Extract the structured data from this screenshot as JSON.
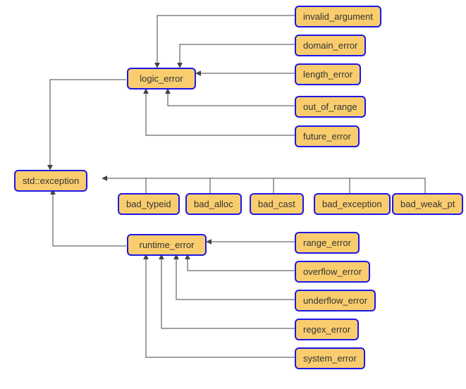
{
  "nodes": {
    "std_exception": "std::exception",
    "logic_error": "logic_error",
    "runtime_error": "runtime_error",
    "invalid_argument": "invalid_argument",
    "domain_error": "domain_error",
    "length_error": "length_error",
    "out_of_range": "out_of_range",
    "future_error": "future_error",
    "bad_typeid": "bad_typeid",
    "bad_alloc": "bad_alloc",
    "bad_cast": "bad_cast",
    "bad_exception": "bad_exception",
    "bad_weak_pt": "bad_weak_pt",
    "range_error": "range_error",
    "overflow_error": "overflow_error",
    "underflow_error": "underflow_error",
    "regex_error": "regex_error",
    "system_error": "system_error"
  },
  "chart_data": {
    "type": "diagram",
    "title": "",
    "root": "std::exception",
    "edges": [
      {
        "from": "invalid_argument",
        "to": "logic_error"
      },
      {
        "from": "domain_error",
        "to": "logic_error"
      },
      {
        "from": "length_error",
        "to": "logic_error"
      },
      {
        "from": "out_of_range",
        "to": "logic_error"
      },
      {
        "from": "future_error",
        "to": "logic_error"
      },
      {
        "from": "logic_error",
        "to": "std::exception"
      },
      {
        "from": "bad_typeid",
        "to": "std::exception"
      },
      {
        "from": "bad_alloc",
        "to": "std::exception"
      },
      {
        "from": "bad_cast",
        "to": "std::exception"
      },
      {
        "from": "bad_exception",
        "to": "std::exception"
      },
      {
        "from": "bad_weak_pt",
        "to": "std::exception"
      },
      {
        "from": "runtime_error",
        "to": "std::exception"
      },
      {
        "from": "range_error",
        "to": "runtime_error"
      },
      {
        "from": "overflow_error",
        "to": "runtime_error"
      },
      {
        "from": "underflow_error",
        "to": "runtime_error"
      },
      {
        "from": "regex_error",
        "to": "runtime_error"
      },
      {
        "from": "system_error",
        "to": "runtime_error"
      }
    ]
  }
}
